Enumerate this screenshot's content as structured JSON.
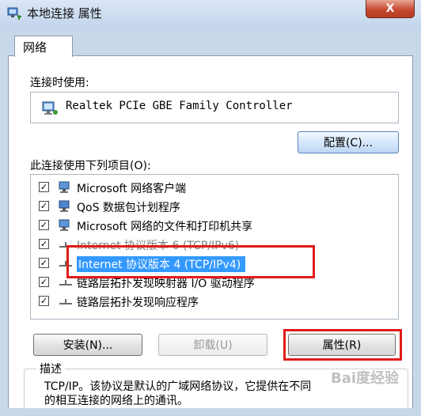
{
  "window": {
    "title": "本地连接 属性",
    "close_label": "X"
  },
  "tab": {
    "label": "网络"
  },
  "connect_using": {
    "label": "连接时使用:",
    "adapter": "Realtek PCIe GBE Family Controller",
    "configure_button": "配置(C)..."
  },
  "items": {
    "label": "此连接使用下列项目(O):",
    "list": [
      {
        "text": "Microsoft 网络客户端",
        "checked": true,
        "icon": "network-client-icon"
      },
      {
        "text": "QoS 数据包计划程序",
        "checked": true,
        "icon": "qos-icon"
      },
      {
        "text": "Microsoft 网络的文件和打印机共享",
        "checked": true,
        "icon": "file-printer-sharing-icon"
      },
      {
        "text": "Internet 协议版本 6 (TCP/IPv6)",
        "checked": true,
        "icon": "protocol-icon"
      },
      {
        "text": "Internet 协议版本 4 (TCP/IPv4)",
        "checked": true,
        "icon": "protocol-icon"
      },
      {
        "text": "链路层拓扑发现映射器 I/O 驱动程序",
        "checked": true,
        "icon": "protocol-icon"
      },
      {
        "text": "链路层拓扑发现响应程序",
        "checked": true,
        "icon": "protocol-icon"
      }
    ]
  },
  "buttons": {
    "install": "安装(N)...",
    "uninstall": "卸载(U)",
    "properties": "属性(R)"
  },
  "description": {
    "title": "描述",
    "line1": "TCP/IP。该协议是默认的广域网络协议，它提供在不同",
    "line2": "的相互连接的网络上的通讯。"
  },
  "watermark": "Bai度经验",
  "colors": {
    "highlight_border": "#e01b1b",
    "selection": "#3399ff"
  }
}
